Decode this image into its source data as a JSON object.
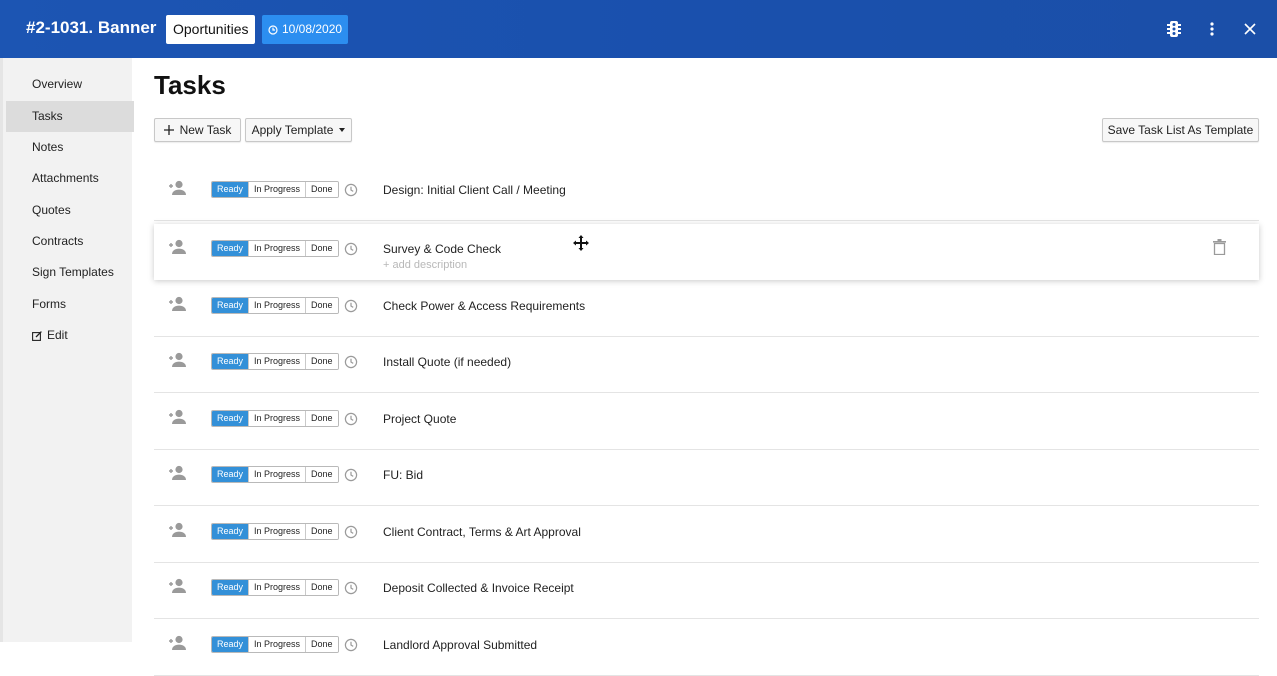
{
  "header": {
    "title": "#2-1031. Banner",
    "stage": "Oportunities",
    "date": "10/08/2020",
    "icons": [
      "traffic-light-icon",
      "more-vertical-icon",
      "close-icon"
    ],
    "background_color": "#1b52ae"
  },
  "sidebar": {
    "items": [
      {
        "label": "Overview",
        "active": false
      },
      {
        "label": "Tasks",
        "active": true
      },
      {
        "label": "Notes",
        "active": false
      },
      {
        "label": "Attachments",
        "active": false
      },
      {
        "label": "Quotes",
        "active": false
      },
      {
        "label": "Contracts",
        "active": false
      },
      {
        "label": "Sign Templates",
        "active": false
      },
      {
        "label": "Forms",
        "active": false
      },
      {
        "label": "Edit",
        "active": false,
        "icon": "edit-icon"
      }
    ]
  },
  "main": {
    "title": "Tasks",
    "new_task_label": "New Task",
    "apply_template_label": "Apply Template",
    "save_template_label": "Save Task List As Template",
    "status_labels": [
      "Ready",
      "In Progress",
      "Done"
    ],
    "accent_color": "#3390d8",
    "tasks": [
      {
        "name": "Design: Initial Client Call / Meeting",
        "status": "Ready"
      },
      {
        "name": "Survey & Code Check",
        "status": "Ready",
        "description_placeholder": "+ add description",
        "hovered": true
      },
      {
        "name": "Check Power & Access Requirements",
        "status": "Ready"
      },
      {
        "name": "Install Quote (if needed)",
        "status": "Ready"
      },
      {
        "name": "Project Quote",
        "status": "Ready"
      },
      {
        "name": "FU: Bid",
        "status": "Ready"
      },
      {
        "name": "Client Contract, Terms & Art Approval",
        "status": "Ready"
      },
      {
        "name": "Deposit Collected & Invoice Receipt",
        "status": "Ready"
      },
      {
        "name": "Landlord Approval Submitted",
        "status": "Ready"
      }
    ]
  }
}
